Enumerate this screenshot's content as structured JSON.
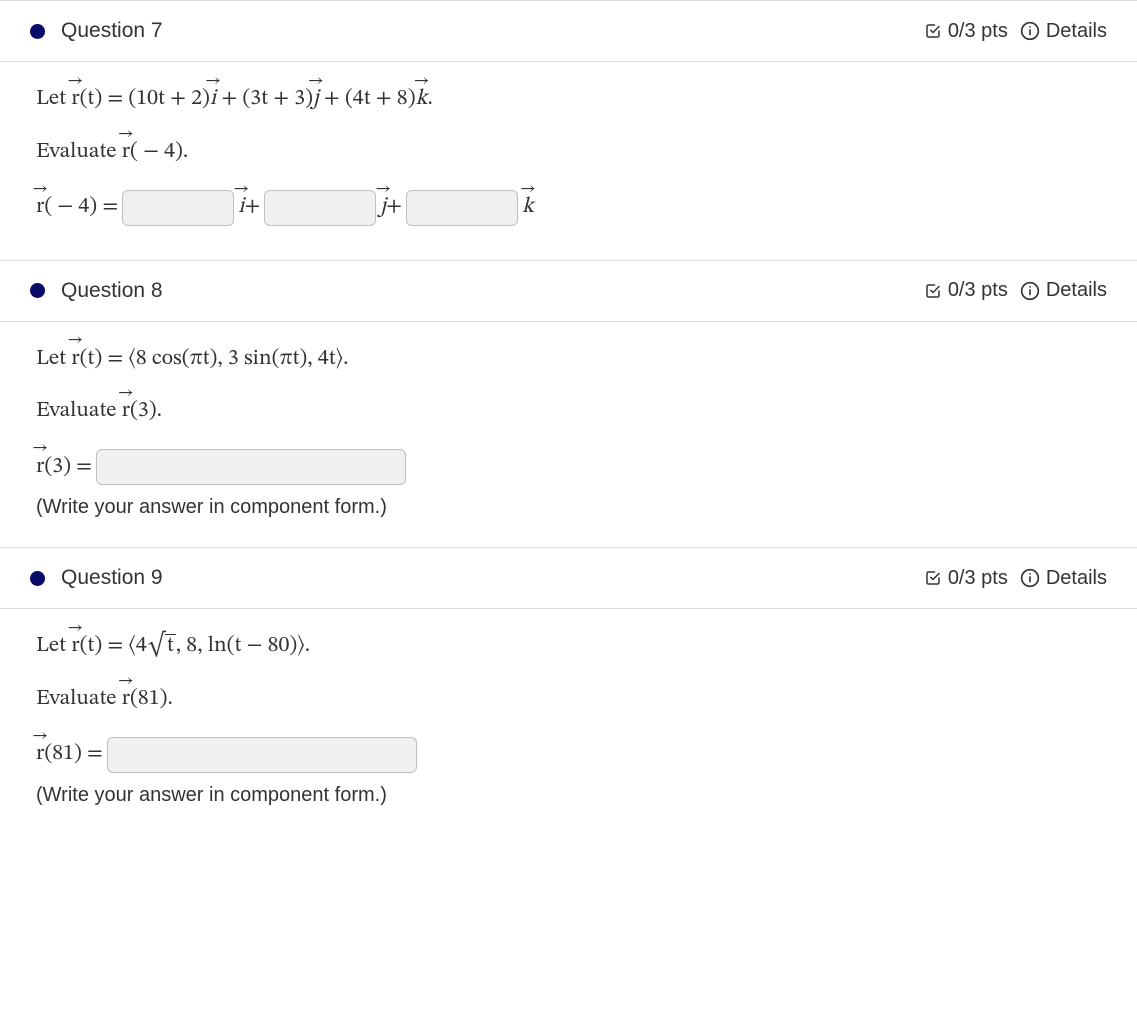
{
  "labels": {
    "details": "Details"
  },
  "questions": [
    {
      "num": "7",
      "title": "Question 7",
      "score": "0/3 pts",
      "body": {
        "let_prefix": "Let ",
        "rt_lhs": "(t) = ",
        "term_i": "(10t + 2)",
        "term_j": "(3t + 3)",
        "term_k": "(4t + 8)",
        "period": ".",
        "eval_prefix": "Evaluate ",
        "eval_arg": "( − 4).",
        "answer_lhs_arg": "( − 4) = ",
        "plus": " + "
      }
    },
    {
      "num": "8",
      "title": "Question 8",
      "score": "0/3 pts",
      "body": {
        "let_prefix": "Let ",
        "rt_lhs": "(t) = ",
        "vector_expr": "⟨8 cos(πt), 3 sin(πt), 4t⟩.",
        "eval_prefix": "Evaluate ",
        "eval_arg": "(3).",
        "answer_lhs_arg": "(3) = ",
        "note": "(Write your answer in component form.)"
      }
    },
    {
      "num": "9",
      "title": "Question 9",
      "score": "0/3 pts",
      "body": {
        "let_prefix": "Let ",
        "rt_lhs": "(t) = ",
        "vec_open": "⟨4",
        "sqrt_arg": "t",
        "vec_rest": ", 8, ln(t − 80)⟩.",
        "eval_prefix": "Evaluate ",
        "eval_arg": "(81).",
        "answer_lhs_arg": "(81) = ",
        "note": "(Write your answer in component form.)"
      }
    }
  ]
}
